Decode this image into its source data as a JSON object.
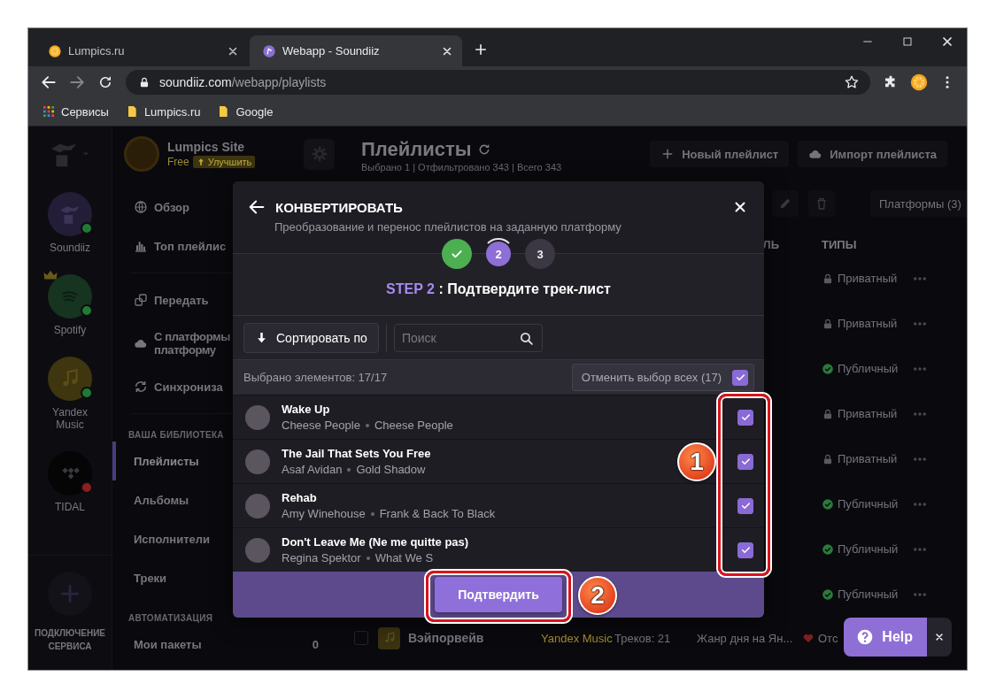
{
  "browser": {
    "tabs": [
      {
        "title": "Lumpics.ru",
        "selected": false
      },
      {
        "title": "Webapp - Soundiiz",
        "selected": true
      }
    ],
    "url": {
      "host": "soundiiz.com",
      "path": "/webapp/playlists"
    },
    "bookmarks": [
      {
        "label": "Сервисы",
        "kind": "apps"
      },
      {
        "label": "Lumpics.ru",
        "kind": "folder"
      },
      {
        "label": "Google",
        "kind": "folder"
      }
    ]
  },
  "rail": {
    "services": [
      {
        "name": "Soundiiz",
        "color": "#1f7a34"
      },
      {
        "name": "Spotify",
        "color": "#1f7a34"
      },
      {
        "name": "Yandex Music",
        "color": "#1f7a34"
      },
      {
        "name": "TIDAL",
        "color": "#8b1e1e"
      }
    ],
    "connect": "ПОДКЛЮЧЕНИЕ СЕРВИСА"
  },
  "account": {
    "name": "Lumpics Site",
    "plan": "Free",
    "upgrade": "Улучшить"
  },
  "nav": [
    {
      "items": [
        {
          "label": "Обзор",
          "selected": false
        },
        {
          "label": "Топ плейлис",
          "selected": false
        }
      ]
    },
    {
      "items": [
        {
          "label": "Передать",
          "selected": false
        },
        {
          "label": "С платформы\nплатформу",
          "selected": false
        },
        {
          "label": "Синхрониза",
          "selected": false
        }
      ]
    },
    {
      "heading": "ВАША БИБЛИОТЕКА",
      "items": [
        {
          "label": "Плейлисты",
          "selected": true
        },
        {
          "label": "Альбомы",
          "selected": false
        },
        {
          "label": "Исполнители",
          "selected": false
        },
        {
          "label": "Треки",
          "selected": false
        }
      ]
    },
    {
      "heading": "АВТОМАТИЗАЦИЯ",
      "items": [
        {
          "label": "Мои пакеты",
          "count": "0",
          "selected": false
        }
      ]
    }
  ],
  "main": {
    "title": "Плейлисты",
    "summary": "Выбрано 1 | Отфильтровано 343 | Всего 343",
    "actions": [
      "Новый плейлист",
      "Импорт плейлиста"
    ],
    "filter": "Платформы (3)",
    "columns": [
      "ЛЬ",
      "ТИПЫ"
    ],
    "rows": [
      {
        "type": "Приватный",
        "kind": "private"
      },
      {
        "type": "Приватный",
        "kind": "private"
      },
      {
        "type": "Публичный",
        "kind": "public"
      },
      {
        "type": "Приватный",
        "kind": "private"
      },
      {
        "type": "Приватный",
        "kind": "private"
      },
      {
        "type": "Публичный",
        "kind": "public"
      },
      {
        "type": "Публичный",
        "kind": "public"
      },
      {
        "type": "Публичный",
        "kind": "public"
      }
    ],
    "last_row": {
      "checked": false,
      "title": "Вэйпорвейв",
      "platform": "Yandex Music",
      "tracks": "Треков: 21",
      "description": "Жанр дня на Ян...",
      "status": "Отс"
    }
  },
  "modal": {
    "title": "КОНВЕРТИРОВАТЬ",
    "subtitle": "Преобразование и перенос плейлистов на заданную платформу",
    "steps": [
      {
        "completed": true,
        "selected": false
      },
      {
        "number": "2",
        "completed": false,
        "selected": true
      },
      {
        "number": "3",
        "completed": false,
        "selected": false
      }
    ],
    "step_label": "STEP 2",
    "step_title": ": Подтвердите трек-лист",
    "sort": "Сортировать по",
    "search_placeholder": "Поиск",
    "selected_count": "Выбрано элементов: 17/17",
    "deselect_all": {
      "label": "Отменить выбор всех (17)",
      "checked": true
    },
    "tracks": [
      {
        "title": "Wake Up",
        "artist": "Cheese People",
        "album": "Cheese People",
        "checked": true
      },
      {
        "title": "The Jail That Sets You Free",
        "artist": "Asaf Avidan",
        "album": "Gold Shadow",
        "checked": true
      },
      {
        "title": "Rehab",
        "artist": "Amy Winehouse",
        "album": "Frank & Back To Black",
        "checked": true
      },
      {
        "title": "Don't Leave Me (Ne me quitte pas)",
        "artist": "Regina Spektor",
        "album": "What We S",
        "checked": true
      }
    ],
    "confirm": "Подтвердить"
  },
  "annotations": {
    "checkboxes": "1",
    "confirm": "2"
  },
  "help": {
    "label": "Help"
  }
}
